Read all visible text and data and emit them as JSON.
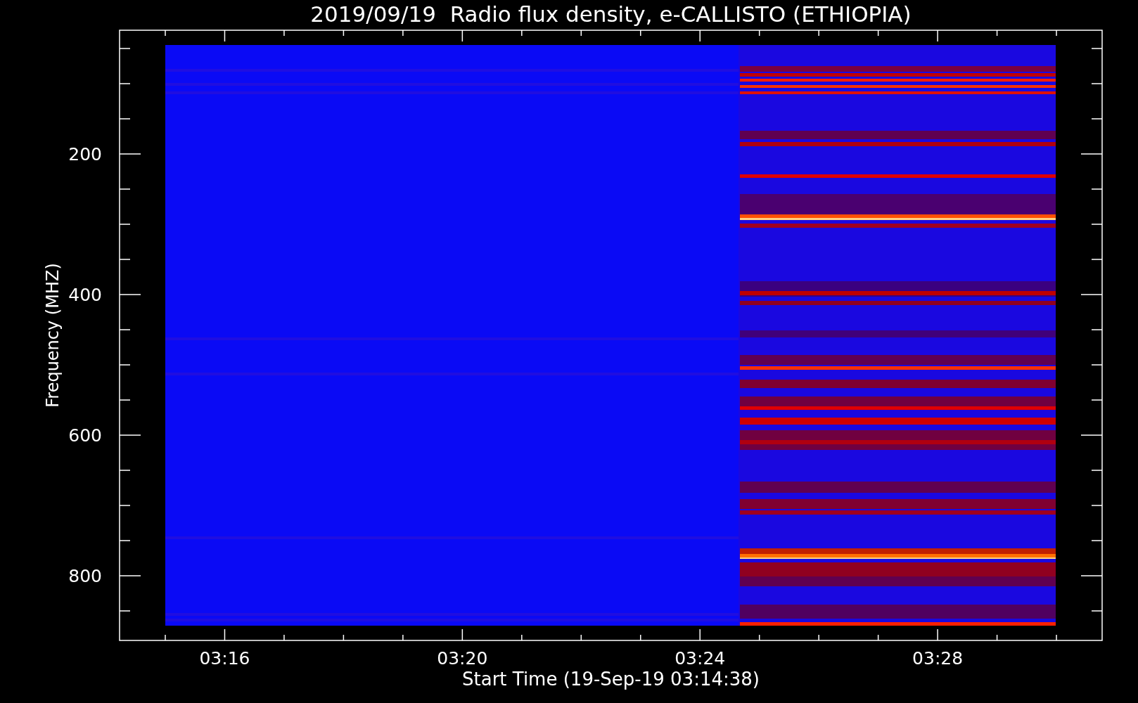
{
  "chart": {
    "title": "2019/09/19  Radio flux density, e-CALLISTO (ETHIOPIA)",
    "xlabel": "Start Time (19-Sep-19 03:14:38)",
    "ylabel": "Frequency (MHZ)",
    "xticks": [
      "03:16",
      "03:20",
      "03:24",
      "03:28"
    ],
    "yticks": [
      "200",
      "400",
      "600",
      "800"
    ]
  }
}
